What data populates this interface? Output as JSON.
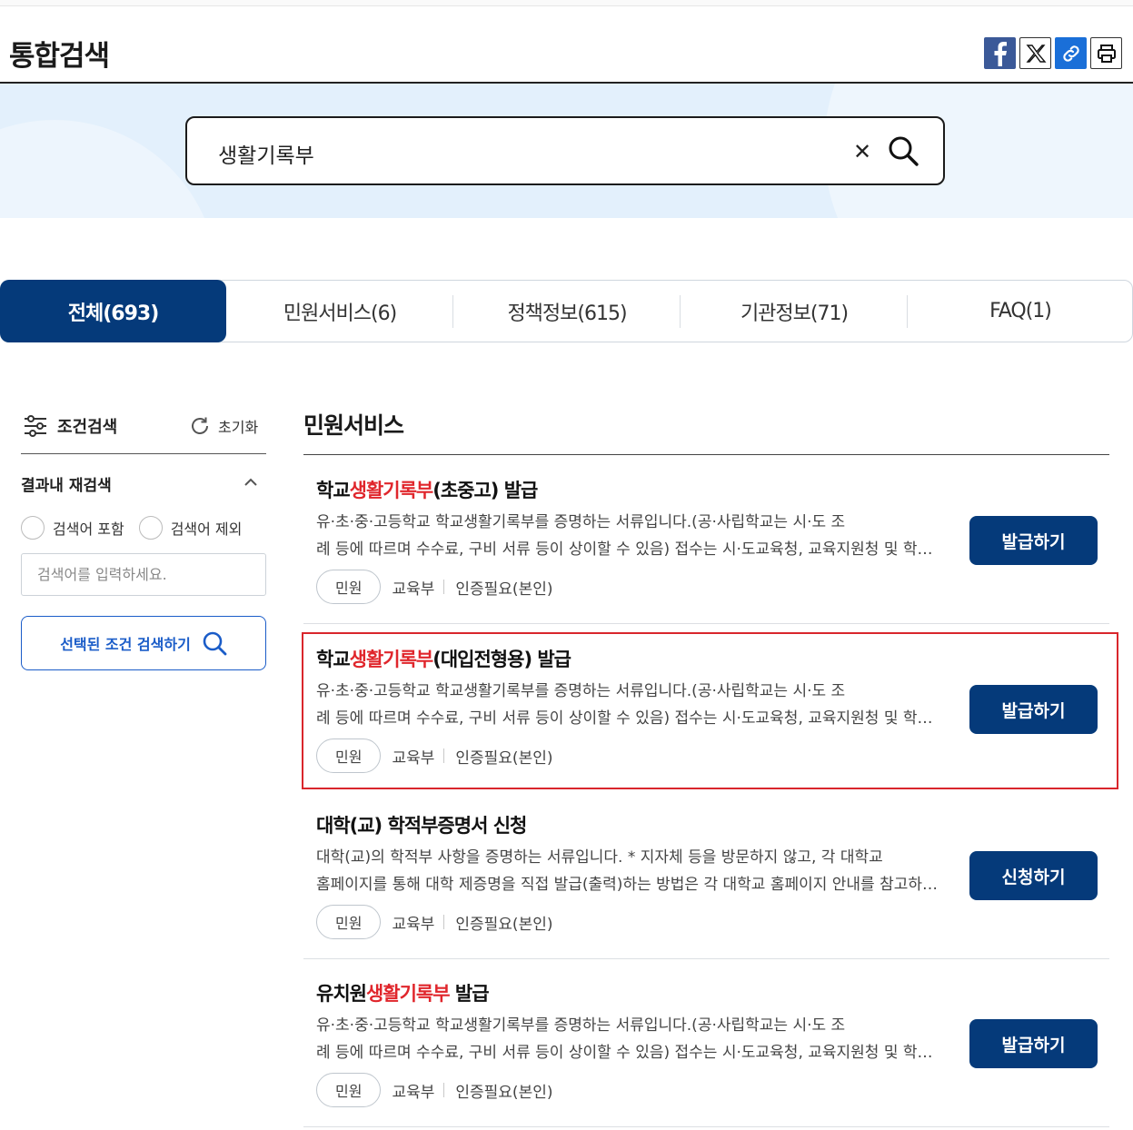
{
  "header": {
    "title": "통합검색",
    "share_icons": [
      "facebook-icon",
      "x-icon",
      "link-icon",
      "print-icon"
    ]
  },
  "search": {
    "query": "생활기록부"
  },
  "tabs": [
    {
      "label": "전체(693)",
      "active": true
    },
    {
      "label": "민원서비스(6)",
      "active": false
    },
    {
      "label": "정책정보(615)",
      "active": false
    },
    {
      "label": "기관정보(71)",
      "active": false
    },
    {
      "label": "FAQ(1)",
      "active": false
    }
  ],
  "sidebar": {
    "title": "조건검색",
    "reset_label": "초기화",
    "research_title": "결과내 재검색",
    "radio_include": "검색어 포함",
    "radio_exclude": "검색어 제외",
    "input_placeholder": "검색어를 입력하세요.",
    "search_button": "선택된 조건 검색하기"
  },
  "section": {
    "title": "민원서비스"
  },
  "results": [
    {
      "title_before": "학교",
      "title_highlight": "생활기록부",
      "title_after": "(초중고) 발급",
      "desc_line1": "유·초·중·고등학교 학교생활기록부를 증명하는 서류입니다.(공·사립학교는 시·도 조",
      "desc_line2": "례 등에 따르며 수수료, 구비 서류 등이 상이할 수 있음) 접수는 시·도교육청, 교육지원청 및 학교에서 가능합니다.",
      "tag": "민원",
      "agency": "교육부",
      "auth": "인증필요(본인)",
      "button": "발급하기"
    },
    {
      "title_before": "학교",
      "title_highlight": "생활기록부",
      "title_after": "(대입전형용) 발급",
      "desc_line1": "유·초·중·고등학교 학교생활기록부를 증명하는 서류입니다.(공·사립학교는 시·도 조",
      "desc_line2": "례 등에 따르며 수수료, 구비 서류 등이 상이할 수 있음) 접수는 시·도교육청, 교육지원청 및 학교에서 가능합니다.",
      "tag": "민원",
      "agency": "교육부",
      "auth": "인증필요(본인)",
      "button": "발급하기",
      "highlighted": true
    },
    {
      "title_before": "대학(교) 학적부증명서 신청",
      "title_highlight": "",
      "title_after": "",
      "desc_line1": "대학(교)의 학적부 사항을 증명하는 서류입니다. * 지자체 등을 방문하지 않고, 각 대학교",
      "desc_line2": "홈페이지를 통해 대학 제증명을 직접 발급(출력)하는 방법은 각 대학교 홈페이지 안내를 참고하시기 바랍니다.",
      "tag": "민원",
      "agency": "교육부",
      "auth": "인증필요(본인)",
      "button": "신청하기"
    },
    {
      "title_before": "유치원",
      "title_highlight": "생활기록부",
      "title_after": " 발급",
      "desc_line1": "유·초·중·고등학교 학교생활기록부를 증명하는 서류입니다.(공·사립학교는 시·도 조",
      "desc_line2": "례 등에 따르며 수수료, 구비 서류 등이 상이할 수 있음) 접수는 시·도교육청, 교육지원청 및 학교에서 가능합니다.",
      "tag": "민원",
      "agency": "교육부",
      "auth": "인증필요(본인)",
      "button": "발급하기"
    }
  ],
  "colors": {
    "primary_navy": "#053a7a",
    "highlight_red": "#e0262c",
    "band_blue": "#e3f0fc",
    "focus_border": "#d9262c"
  }
}
